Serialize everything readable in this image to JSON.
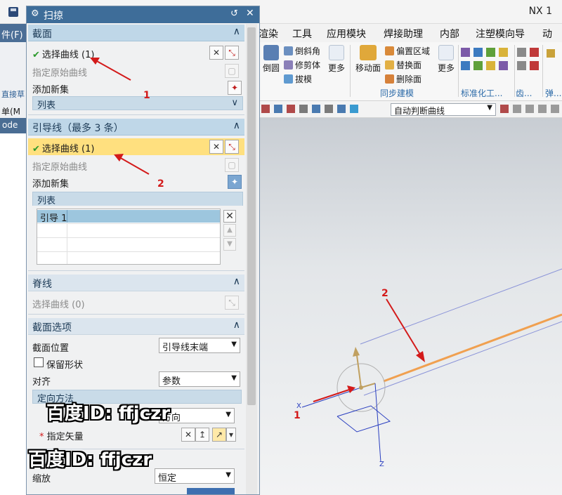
{
  "app": {
    "title": "NX 1",
    "save_icon": "save-icon"
  },
  "menubar": {
    "left_fragment": "件(F)",
    "items": [
      "渲染",
      "工具",
      "应用模块",
      "焊接助理",
      "内部",
      "注塑模向导",
      "动"
    ]
  },
  "left_strip": {
    "label_1": "直接草",
    "label_2": "单(M",
    "mode_tab": "ode"
  },
  "ribbon": {
    "chamfer": "倒圆",
    "small_col1": [
      "倒斜角",
      "修剪体",
      "拔模"
    ],
    "more_1": "更多",
    "move_face": "移动面",
    "small_col2": [
      "偏置区域",
      "替换面",
      "删除面"
    ],
    "more_2": "更多",
    "group_sync": "同步建模",
    "group_std": "标准化工...",
    "group_gear": "齿...",
    "group_spring": "弹..."
  },
  "toolbar2": {
    "filter_value": "自动判断曲线"
  },
  "dialog": {
    "title": "扫掠",
    "section_curve": {
      "header": "截面",
      "select_curve": "选择曲线 (1)",
      "specify_original": "指定原始曲线",
      "add_new_set": "添加新集",
      "list_header": "列表"
    },
    "guide": {
      "header": "引导线（最多 3 条）",
      "select_curve": "选择曲线 (1)",
      "specify_original": "指定原始曲线",
      "add_new_set": "添加新集",
      "list_header": "列表",
      "list_item": "引导 1"
    },
    "spine": {
      "header": "脊线",
      "select_curve": "选择曲线 (0)"
    },
    "section_options": {
      "header": "截面选项",
      "position_label": "截面位置",
      "position_value": "引导线末端",
      "preserve_shape": "保留形状",
      "align_label": "对齐",
      "align_value": "参数",
      "orientation_header": "定向方法",
      "orientation_value": "方向",
      "vector_label": "指定矢量",
      "scale_label": "缩放",
      "scale_value": "恒定"
    }
  },
  "annotations": {
    "num_1a": "1",
    "num_2a": "2",
    "num_2b": "2",
    "num_1b": "1",
    "watermark": "百度ID: ffjczr"
  },
  "viewport": {
    "axis_x": "X",
    "axis_z": "Z"
  },
  "colors": {
    "accent": "#3e6d99",
    "highlight": "#ffe07f",
    "guide_curve": "#f0a050",
    "arrow": "#d31a1a"
  }
}
